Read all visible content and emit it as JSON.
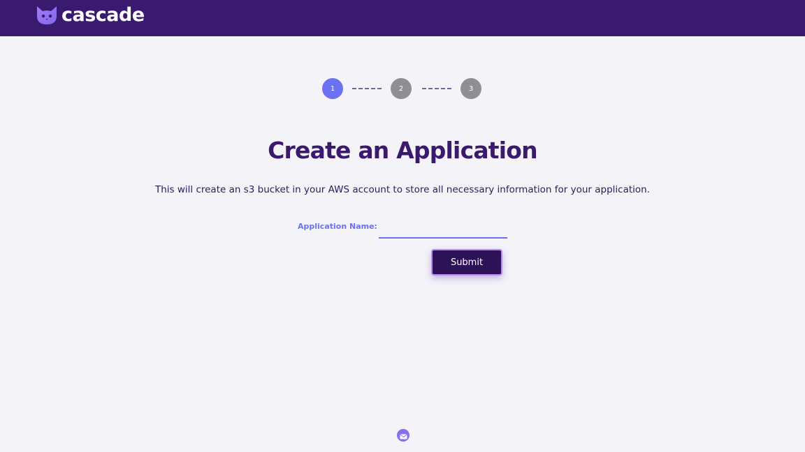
{
  "header": {
    "brand_name": "cascade",
    "logo_icon": "cat-icon",
    "background_color": "#3a1a6e"
  },
  "stepper": {
    "steps": [
      {
        "label": "1",
        "state": "active"
      },
      {
        "label": "2",
        "state": "inactive"
      },
      {
        "label": "3",
        "state": "inactive"
      }
    ],
    "active_color": "#6b72f2",
    "inactive_color": "#8e8e93"
  },
  "main": {
    "title": "Create an Application",
    "description": "This will create an s3 bucket in your AWS account to store all necessary information for your application.",
    "form": {
      "application_name_label": "Application Name:",
      "application_name_value": "",
      "submit_label": "Submit"
    }
  },
  "footer": {
    "contact_icon": "mail-icon"
  },
  "colors": {
    "accent": "#6b72f2",
    "brand_dark": "#3b1a6e",
    "page_background": "#f4f3f8"
  }
}
